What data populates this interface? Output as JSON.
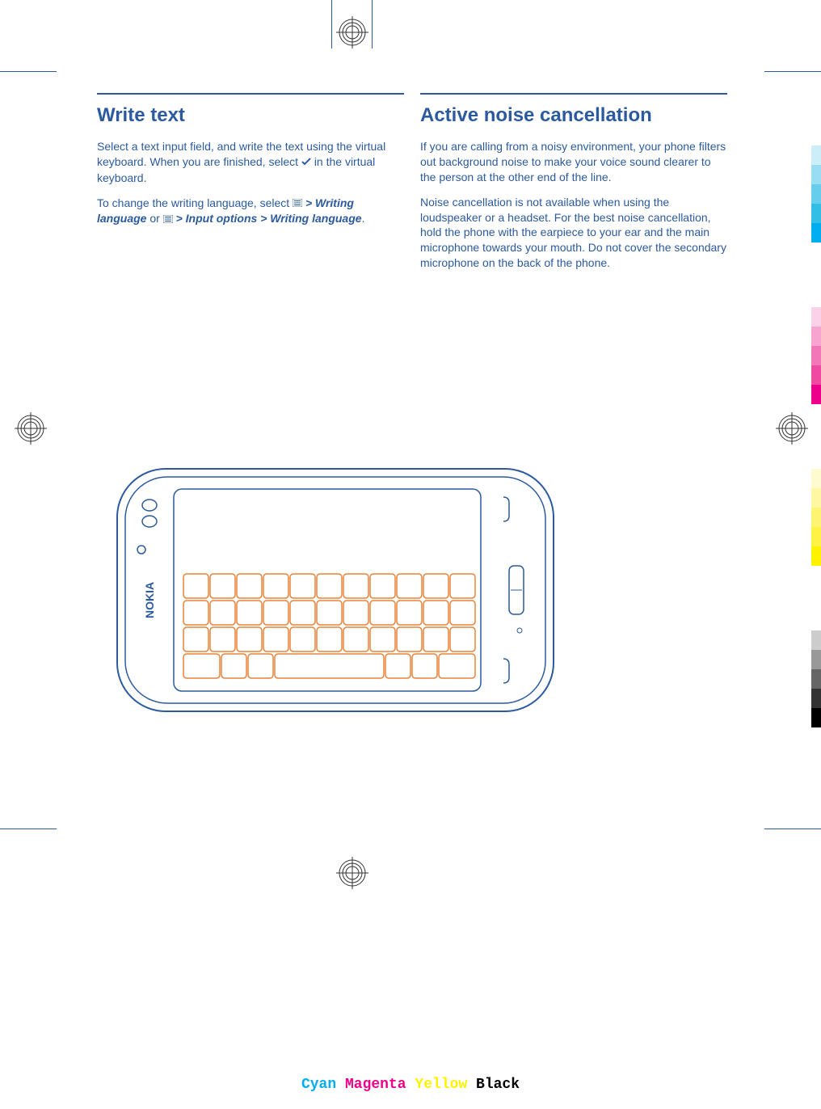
{
  "sections": {
    "writeText": {
      "heading": "Write text",
      "p1_a": "Select a text input field, and write the text using the virtual keyboard. When you are finished, select ",
      "p1_b": " in the virtual keyboard.",
      "p2_a": "To change the writing language, select ",
      "p2_b": " > Writing language",
      "p2_c": " or ",
      "p2_d": " > Input options > Writing language",
      "p2_e": "."
    },
    "noiseCancellation": {
      "heading": "Active noise cancellation",
      "p1": "If you are calling from a noisy environment, your phone filters out background noise to make your voice sound clearer to the person at the other end of the line.",
      "p2": "Noise cancellation is not available when using the loudspeaker or a headset. For the best noise cancellation, hold the phone with the earpiece to your ear and the main microphone towards your mouth. Do not cover the secondary microphone on the back of the phone."
    }
  },
  "printColors": {
    "cyan": "Cyan",
    "magenta": "Magenta",
    "yellow": "Yellow",
    "black": "Black"
  },
  "phoneLabel": "NOKIA"
}
